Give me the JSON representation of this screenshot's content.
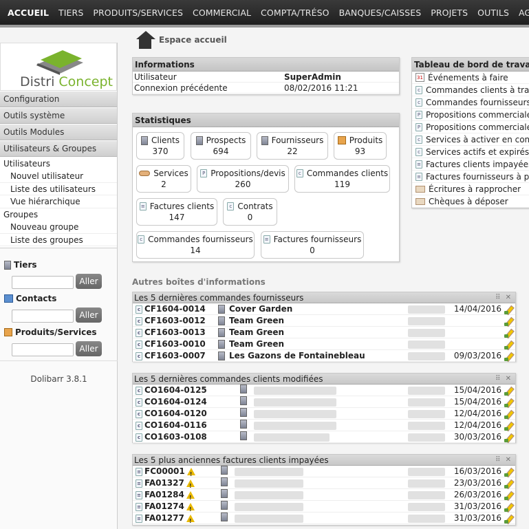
{
  "topnav": [
    "ACCUEIL",
    "TIERS",
    "PRODUITS/SERVICES",
    "COMMERCIAL",
    "COMPTA/TRÉSO",
    "BANQUES/CAISSES",
    "PROJETS",
    "OUTILS",
    "AGEN"
  ],
  "logo": {
    "part1": "Distri",
    "part2": "Concept"
  },
  "sidebar": {
    "heads": [
      "Configuration",
      "Outils système",
      "Outils Modules",
      "Utilisateurs & Groupes"
    ],
    "users_group": {
      "users_label": "Utilisateurs",
      "users_items": [
        "Nouvel utilisateur",
        "Liste des utilisateurs",
        "Vue hiérarchique"
      ],
      "groups_label": "Groupes",
      "groups_items": [
        "Nouveau groupe",
        "Liste des groupes"
      ]
    },
    "searches": [
      {
        "label": "Tiers",
        "button": "Aller",
        "icon": "building-icon"
      },
      {
        "label": "Contacts",
        "button": "Aller",
        "icon": "contact-icon"
      },
      {
        "label": "Produits/Services",
        "button": "Aller",
        "icon": "product-icon"
      }
    ],
    "version": "Dolibarr 3.8.1"
  },
  "page_title": "Espace accueil",
  "info": {
    "title": "Informations",
    "rows": [
      {
        "k": "Utilisateur",
        "v": "SuperAdmin"
      },
      {
        "k": "Connexion précédente",
        "v": "08/02/2016 11:21"
      }
    ]
  },
  "stats": {
    "title": "Statistiques",
    "boxes": [
      {
        "label": "Clients",
        "value": "370"
      },
      {
        "label": "Prospects",
        "value": "694"
      },
      {
        "label": "Fournisseurs",
        "value": "22"
      },
      {
        "label": "Produits",
        "value": "93"
      },
      {
        "label": "Services",
        "value": "2"
      },
      {
        "label": "Propositions/devis",
        "value": "260"
      },
      {
        "label": "Commandes clients",
        "value": "119"
      },
      {
        "label": "Factures clients",
        "value": "147"
      },
      {
        "label": "Contrats",
        "value": "0"
      },
      {
        "label": "Commandes fournisseurs",
        "value": "14"
      },
      {
        "label": "Factures fournisseurs",
        "value": "0"
      }
    ]
  },
  "dashboard": {
    "title": "Tableau de bord de travail",
    "items": [
      "Événements à faire",
      "Commandes clients à traite",
      "Commandes fournisseurs à",
      "Propositions commerciales",
      "Propositions commerciales",
      "Services à activer en contra",
      "Services actifs et expirés e",
      "Factures clients impayées",
      "Factures fournisseurs à pa",
      "Écritures à rapprocher",
      "Chèques à déposer"
    ]
  },
  "other_boxes_label": "Autres boîtes d'informations",
  "lists": [
    {
      "title": "Les 5 dernières commandes fournisseurs",
      "rows": [
        {
          "ref": "CF1604-0014",
          "company": "Cover Garden",
          "date": "14/04/2016"
        },
        {
          "ref": "CF1603-0012",
          "company": "Team Green",
          "date": ""
        },
        {
          "ref": "CF1603-0013",
          "company": "Team Green",
          "date": ""
        },
        {
          "ref": "CF1603-0010",
          "company": "Team Green",
          "date": ""
        },
        {
          "ref": "CF1603-0007",
          "company": "Les Gazons de Fontainebleau",
          "date": "09/03/2016"
        }
      ]
    },
    {
      "title": "Les 5 dernières commandes clients modifiées",
      "rows": [
        {
          "ref": "CO1604-0125",
          "company": "",
          "date": "15/04/2016"
        },
        {
          "ref": "CO1604-0124",
          "company": "",
          "date": "15/04/2016"
        },
        {
          "ref": "CO1604-0120",
          "company": "",
          "date": "12/04/2016"
        },
        {
          "ref": "CO1604-0116",
          "company": "",
          "date": "12/04/2016"
        },
        {
          "ref": "CO1603-0108",
          "company": "",
          "date": "30/03/2016"
        }
      ]
    },
    {
      "title": "Les 5 plus anciennes factures clients impayées",
      "rows": [
        {
          "ref": "FC00001",
          "company": "",
          "date": "16/03/2016"
        },
        {
          "ref": "FA01327",
          "company": "",
          "date": "23/03/2016"
        },
        {
          "ref": "FA01284",
          "company": "",
          "date": "26/03/2016"
        },
        {
          "ref": "FA01274",
          "company": "",
          "date": "31/03/2016"
        },
        {
          "ref": "FA01277",
          "company": "",
          "date": "31/03/2016"
        }
      ]
    }
  ]
}
